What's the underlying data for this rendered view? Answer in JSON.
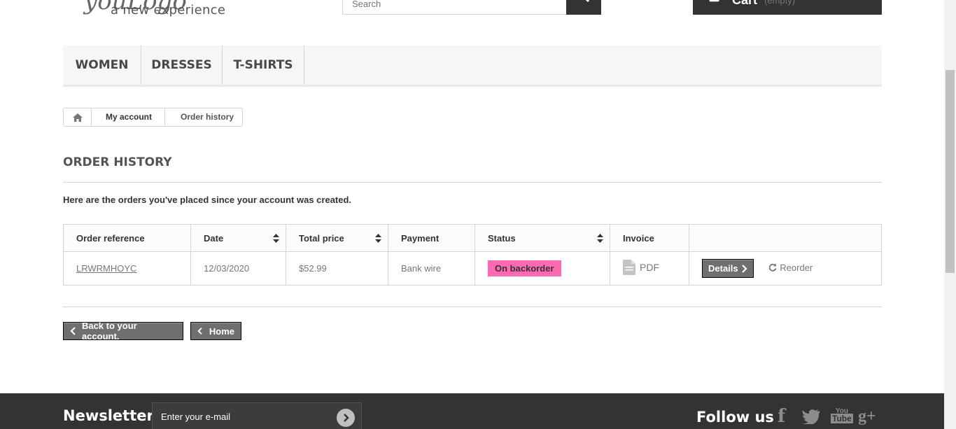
{
  "header": {
    "logo_tagline": "a new experience",
    "search_placeholder": "Search",
    "cart_label": "Cart",
    "cart_status": "(empty)"
  },
  "menu": {
    "items": [
      {
        "label": "WOMEN"
      },
      {
        "label": "DRESSES"
      },
      {
        "label": "T-SHIRTS"
      }
    ]
  },
  "breadcrumb": {
    "home_icon": "home-icon",
    "my_account": "My account",
    "current": "Order history"
  },
  "page": {
    "title": "ORDER HISTORY",
    "intro": "Here are the orders you've placed since your account was created."
  },
  "table": {
    "headers": [
      "Order reference",
      "Date",
      "Total price",
      "Payment",
      "Status",
      "Invoice",
      ""
    ],
    "rows": [
      {
        "reference": "LRWRMHOYC",
        "date": "12/03/2020",
        "total": "$52.99",
        "payment": "Bank wire",
        "status": "On backorder",
        "invoice": "PDF",
        "details_label": "Details",
        "reorder_label": "Reorder"
      }
    ],
    "status_color": "#ff69b4"
  },
  "actions": {
    "back_label": "Back to your account.",
    "home_label": "Home"
  },
  "footer": {
    "newsletter_title": "Newsletter",
    "newsletter_placeholder": "Enter your e-mail",
    "follow_title": "Follow us",
    "social_icons": [
      "facebook-icon",
      "twitter-icon",
      "youtube-icon",
      "google-plus-icon"
    ]
  },
  "colors": {
    "dark": "#333333",
    "button_grey": "#6f6f6f",
    "menu_bg": "#f6f6f6",
    "border": "#d6d4d4"
  }
}
